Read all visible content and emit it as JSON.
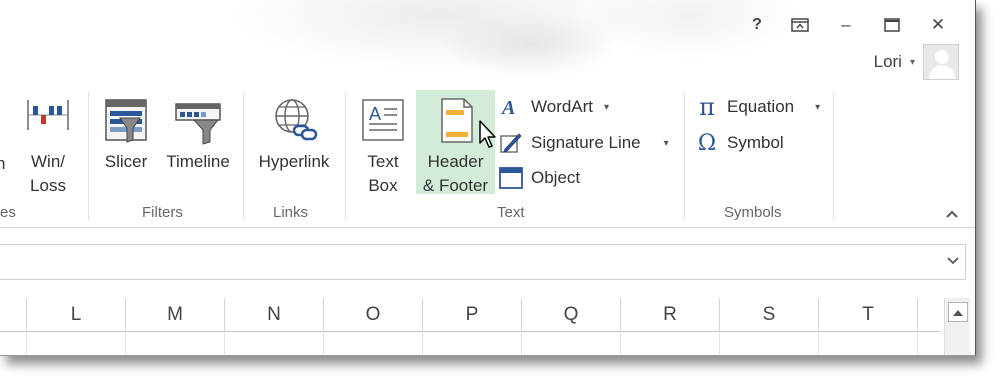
{
  "window": {
    "help": "?",
    "restore_ribbon": "⬒",
    "minimize": "–",
    "maximize": "☐",
    "close": "✕"
  },
  "user": {
    "name": "Lori",
    "caret": "▾"
  },
  "ribbon": {
    "partial_sparkline_suffix": "n",
    "groups": {
      "sparklines_partial": "es",
      "filters": "Filters",
      "links": "Links",
      "text": "Text",
      "symbols": "Symbols"
    },
    "buttons": {
      "winloss_line1": "Win/",
      "winloss_line2": "Loss",
      "slicer": "Slicer",
      "timeline": "Timeline",
      "hyperlink": "Hyperlink",
      "textbox_line1": "Text",
      "textbox_line2": "Box",
      "header_line1": "Header",
      "header_line2": "& Footer",
      "wordart": "WordArt",
      "signature_line": "Signature Line",
      "object": "Object",
      "equation": "Equation",
      "symbol": "Symbol"
    },
    "collapse": "^"
  },
  "formula_bar": {
    "expand": "⌄"
  },
  "grid": {
    "columns": [
      "L",
      "M",
      "N",
      "O",
      "P",
      "Q",
      "R",
      "S",
      "T"
    ]
  },
  "colors": {
    "accent_green": "#217346",
    "active_button_bg": "#d2ecd9",
    "icon_blue": "#2b579a"
  }
}
